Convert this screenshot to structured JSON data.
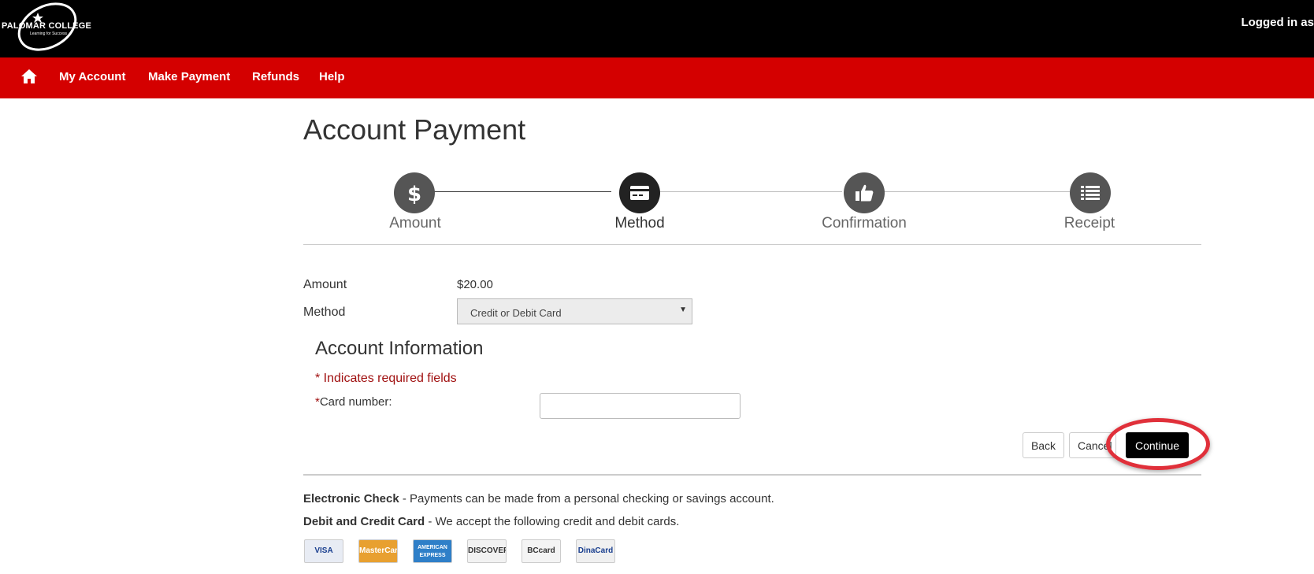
{
  "header": {
    "logo_text": "PALOMAR COLLEGE",
    "logo_tagline": "Learning for Success",
    "logged_in_text": "Logged in as"
  },
  "nav": {
    "items": [
      {
        "label": "My Account"
      },
      {
        "label": "Make Payment"
      },
      {
        "label": "Refunds"
      },
      {
        "label": "Help"
      }
    ]
  },
  "page": {
    "title": "Account Payment"
  },
  "stepper": {
    "steps": [
      {
        "label": "Amount",
        "icon": "dollar-icon",
        "state": "completed"
      },
      {
        "label": "Method",
        "icon": "credit-card-icon",
        "state": "active"
      },
      {
        "label": "Confirmation",
        "icon": "thumbs-up-icon",
        "state": "pending"
      },
      {
        "label": "Receipt",
        "icon": "list-icon",
        "state": "pending"
      }
    ]
  },
  "form": {
    "amount_label": "Amount",
    "amount_value": "$20.00",
    "method_label": "Method",
    "method_selected": "Credit or Debit Card",
    "account_info_title": "Account Information",
    "required_note": "* Indicates required fields",
    "card_number_star": "*",
    "card_number_label": "Card number:",
    "card_number_value": ""
  },
  "buttons": {
    "back": "Back",
    "cancel": "Cancel",
    "continue": "Continue"
  },
  "info": {
    "echeck_title": "Electronic Check",
    "echeck_text": " - Payments can be made from a personal checking or savings  account.",
    "card_title": "Debit and Credit Card",
    "card_text": " - We accept the following credit and debit cards."
  },
  "accepted_cards": [
    {
      "name": "VISA",
      "color": "#1a3f8f",
      "bg": "#e8ecf4"
    },
    {
      "name": "MasterCard",
      "color": "#ffffff",
      "bg": "#e8a030"
    },
    {
      "name": "AMERICAN EXPRESS",
      "color": "#ffffff",
      "bg": "#2f7fc8"
    },
    {
      "name": "DISCOVER",
      "color": "#333333",
      "bg": "#f2f2f2"
    },
    {
      "name": "BCcard",
      "color": "#333333",
      "bg": "#f4f4f4"
    },
    {
      "name": "DinaCard",
      "color": "#1a3f8f",
      "bg": "#f0f0f0"
    }
  ],
  "colors": {
    "nav_red": "#d40000",
    "required_red": "#a01010",
    "highlight_ring": "#e0303a"
  }
}
